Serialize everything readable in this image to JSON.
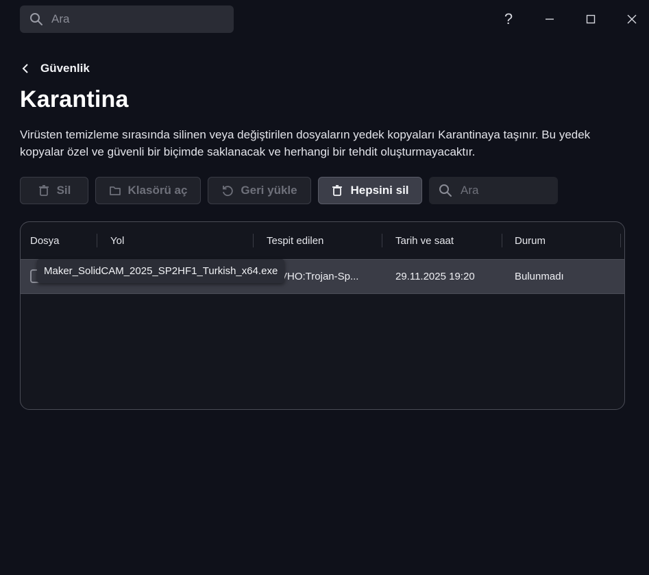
{
  "titlebar": {
    "search_placeholder": "Ara",
    "help_label": "?"
  },
  "nav": {
    "back_label": "Güvenlik"
  },
  "page": {
    "title": "Karantina",
    "description": "Virüsten temizleme sırasında silinen veya değiştirilen dosyaların yedek kopyaları Karantinaya taşınır. Bu yedek kopyalar özel ve güvenli bir biçimde saklanacak ve herhangi bir tehdit oluşturmayacaktır."
  },
  "toolbar": {
    "delete_label": "Sil",
    "open_folder_label": "Klasörü aç",
    "restore_label": "Geri yükle",
    "delete_all_label": "Hepsini sil",
    "search_placeholder": "Ara"
  },
  "table": {
    "columns": [
      "Dosya",
      "Yol",
      "Tespit edilen",
      "Tarih ve saat",
      "Durum"
    ],
    "rows": [
      {
        "file": "Maker_SolidCAM_2025_SP2HF1_Turkish_x64.exe",
        "detected": "VHO:Trojan-Sp...",
        "datetime": "29.11.2025 19:20",
        "status": "Bulunmadı"
      }
    ]
  },
  "tooltip": {
    "text": "Maker_SolidCAM_2025_SP2HF1_Turkish_x64.exe"
  },
  "colors": {
    "background": "#0f111a",
    "detection_dot": "#e04848"
  },
  "icons": [
    "search-icon",
    "help-icon",
    "minimize-icon",
    "maximize-icon",
    "close-icon",
    "chevron-left-icon",
    "trash-icon",
    "folder-icon",
    "restore-icon"
  ]
}
